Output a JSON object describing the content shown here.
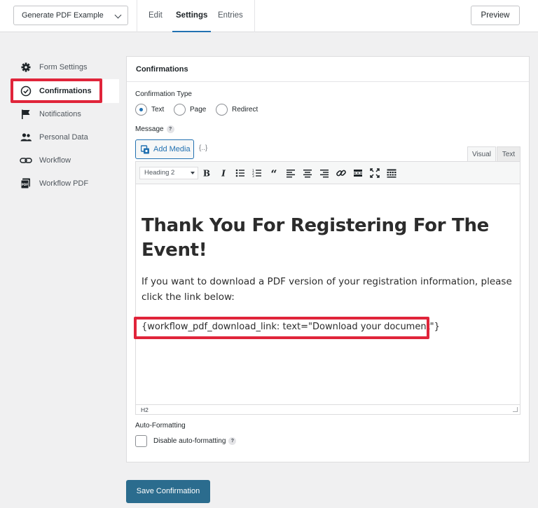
{
  "header": {
    "form_select": "Generate PDF Example",
    "tabs": [
      "Edit",
      "Settings",
      "Entries"
    ],
    "active_tab": "Settings",
    "preview_label": "Preview"
  },
  "sidebar": {
    "items": [
      {
        "label": "Form Settings",
        "icon": "gear-icon"
      },
      {
        "label": "Confirmations",
        "icon": "check-circle-icon"
      },
      {
        "label": "Notifications",
        "icon": "flag-icon"
      },
      {
        "label": "Personal Data",
        "icon": "users-icon"
      },
      {
        "label": "Workflow",
        "icon": "workflow-link-icon"
      },
      {
        "label": "Workflow PDF",
        "icon": "pdf-icon"
      }
    ],
    "active": "Confirmations"
  },
  "panel": {
    "title": "Confirmations",
    "confirmation_type_label": "Confirmation Type",
    "types": [
      "Text",
      "Page",
      "Redirect"
    ],
    "selected_type": "Text",
    "message_label": "Message",
    "help_mark": "?",
    "add_media_label": "Add Media",
    "merge_tag_label": "{..}",
    "editor_tabs": [
      "Visual",
      "Text"
    ],
    "format_select": "Heading 2",
    "toolbar_icons": [
      "bold-icon",
      "italic-icon",
      "bullet-list-icon",
      "numbered-list-icon",
      "blockquote-icon",
      "align-left-icon",
      "align-center-icon",
      "align-right-icon",
      "link-icon",
      "read-more-icon",
      "fullscreen-icon",
      "toolbar-toggle-icon"
    ],
    "content_heading": "Thank You For Registering For The Event!",
    "content_paragraph": "If you want to download a PDF version of your registration information, please click the link below:",
    "content_shortcode": "{workflow_pdf_download_link: text=\"Download your document\"}",
    "status_path": "H2",
    "auto_formatting_label": "Auto-Formatting",
    "disable_auto_formatting_label": "Disable auto-formatting"
  },
  "save_label": "Save Confirmation",
  "colors": {
    "accent": "#2271b1",
    "save_button": "#2b6c8e",
    "highlight_box": "#e0243a"
  }
}
